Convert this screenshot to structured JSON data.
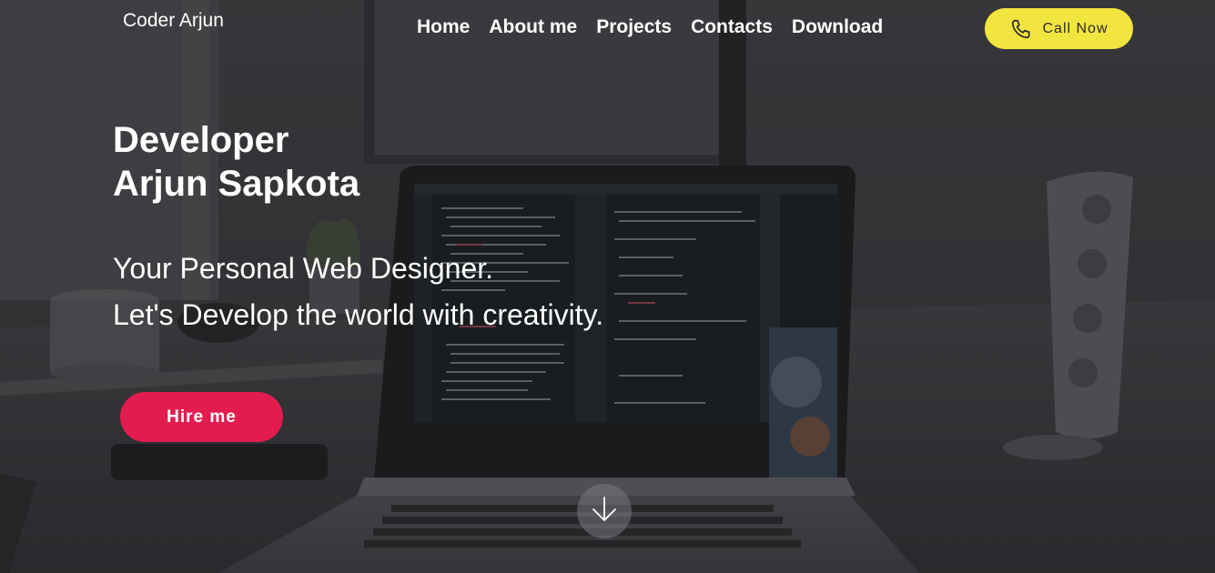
{
  "brand": {
    "name": "Coder Arjun"
  },
  "nav": {
    "items": [
      {
        "label": "Home"
      },
      {
        "label": "About me"
      },
      {
        "label": "Projects"
      },
      {
        "label": "Contacts"
      },
      {
        "label": "Download"
      }
    ]
  },
  "cta": {
    "call_label": "Call Now",
    "call_icon": "phone-icon",
    "call_color": "#f3e540"
  },
  "hero": {
    "headline_line1": "Developer",
    "headline_line2": "Arjun Sapkota",
    "tagline_line1": "Your Personal Web Designer.",
    "tagline_line2": "Let's Develop the world with creativity.",
    "hire_label": "Hire me",
    "hire_color": "#e31c4f",
    "scroll_icon": "arrow-down-icon"
  }
}
